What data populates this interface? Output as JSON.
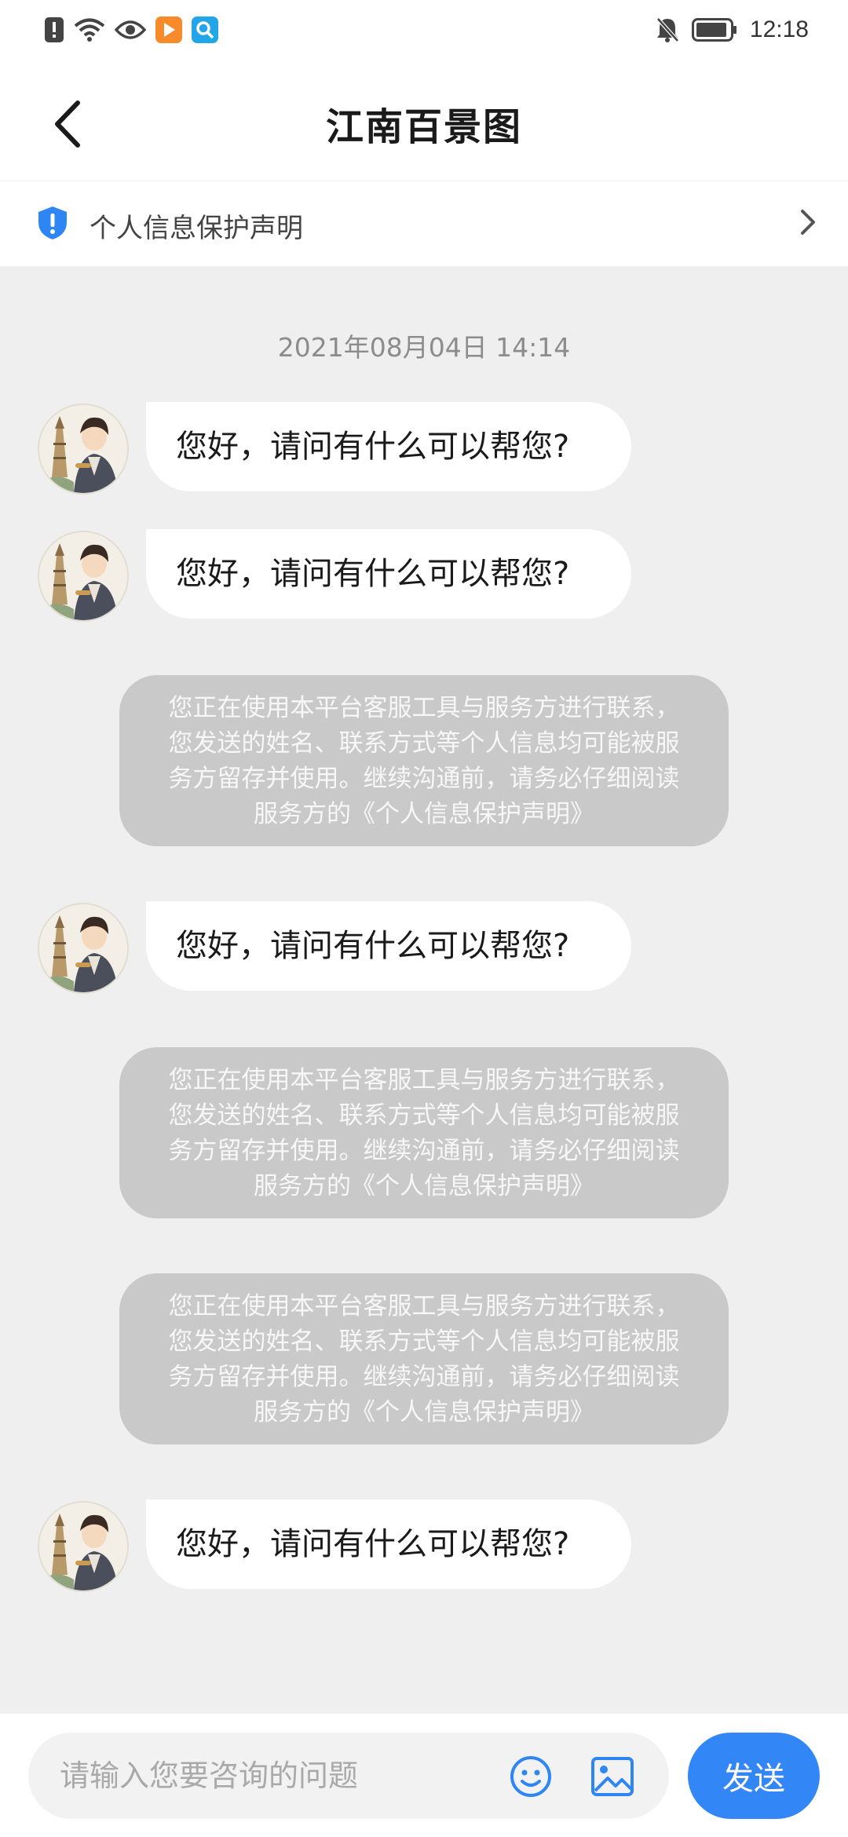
{
  "status_bar": {
    "time": "12:18",
    "icons": [
      "alert-icon",
      "wifi-icon",
      "eye-icon",
      "app-icon",
      "search-app-icon",
      "bell-off-icon",
      "battery-icon"
    ]
  },
  "header": {
    "title": "江南百景图",
    "back_icon": "chevron-left-icon"
  },
  "privacy_banner": {
    "label": "个人信息保护声明",
    "icon": "shield-icon"
  },
  "chat": {
    "timestamp": "2021年08月04日 14:14",
    "items": [
      {
        "type": "agent",
        "text": "您好，请问有什么可以帮您?"
      },
      {
        "type": "agent",
        "text": "您好，请问有什么可以帮您?"
      },
      {
        "type": "notice",
        "lines": [
          "您正在使用本平台客服工具与服务方进行联系，",
          "您发送的姓名、联系方式等个人信息均可能被服",
          "务方留存并使用。继续沟通前，请务必仔细阅读",
          "服务方的《个人信息保护声明》"
        ]
      },
      {
        "type": "agent",
        "text": "您好，请问有什么可以帮您?"
      },
      {
        "type": "notice",
        "lines": [
          "您正在使用本平台客服工具与服务方进行联系，",
          "您发送的姓名、联系方式等个人信息均可能被服",
          "务方留存并使用。继续沟通前，请务必仔细阅读",
          "服务方的《个人信息保护声明》"
        ]
      },
      {
        "type": "notice",
        "lines": [
          "您正在使用本平台客服工具与服务方进行联系，",
          "您发送的姓名、联系方式等个人信息均可能被服",
          "务方留存并使用。继续沟通前，请务必仔细阅读",
          "服务方的《个人信息保护声明》"
        ]
      },
      {
        "type": "agent",
        "text": "您好，请问有什么可以帮您?"
      }
    ]
  },
  "input_bar": {
    "placeholder": "请输入您要咨询的问题",
    "value": "",
    "send_label": "发送"
  },
  "colors": {
    "accent": "#3386f6",
    "background": "#efefef",
    "notice_bg": "#c9c9c9"
  }
}
